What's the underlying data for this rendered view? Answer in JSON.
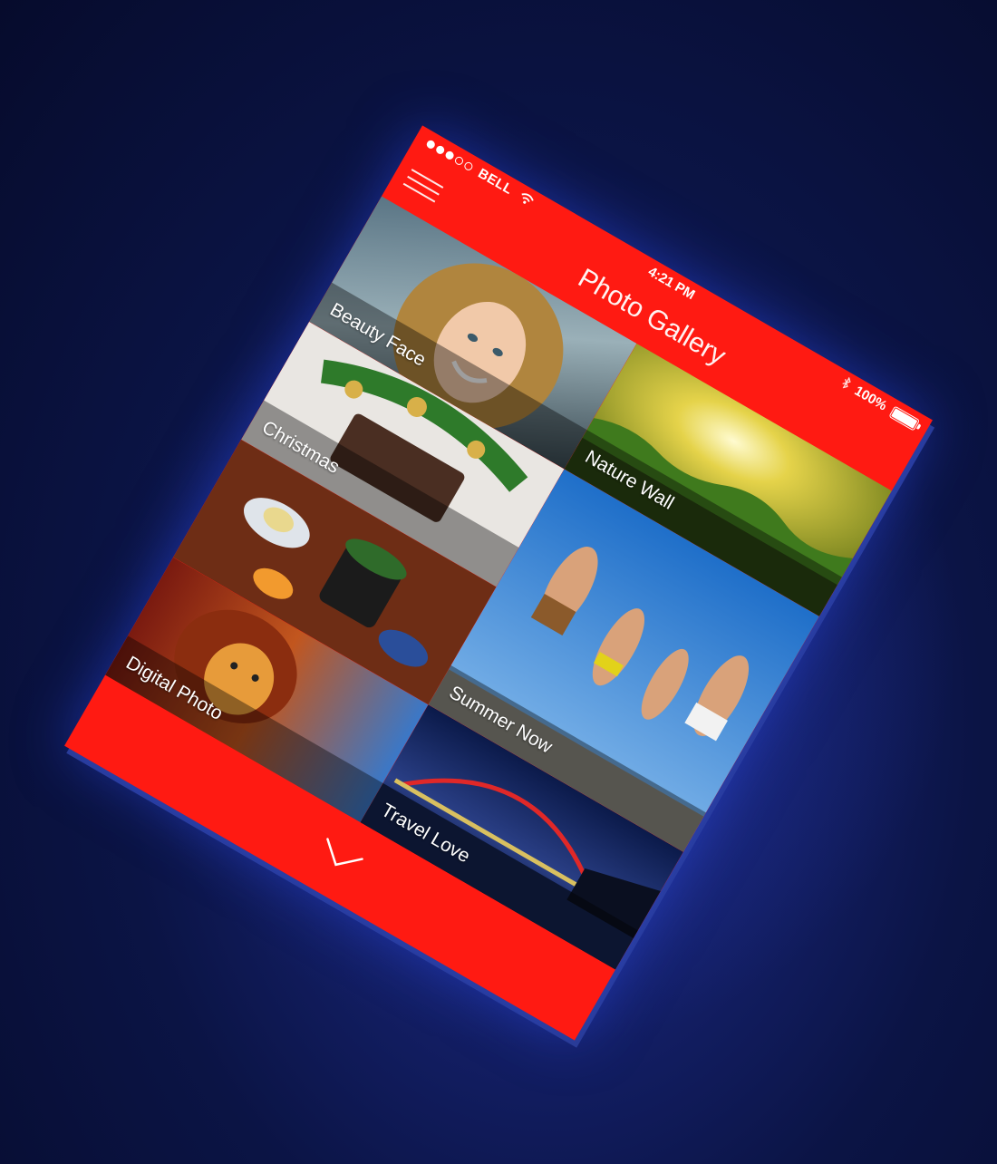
{
  "status_bar": {
    "signal_filled": 3,
    "signal_total": 5,
    "carrier": "BELL",
    "time": "4:21 PM",
    "battery_text": "100%",
    "battery_level": 1.0
  },
  "nav": {
    "title": "Photo Gallery",
    "menu_icon": "hamburger-menu-icon"
  },
  "tiles": [
    {
      "label": "Beauty Face"
    },
    {
      "label": "Nature Wall"
    },
    {
      "label": "Christmas"
    },
    {
      "label": "Summer Now"
    },
    {
      "label": "Digital Photo"
    },
    {
      "label": "Travel Love"
    }
  ],
  "footer": {
    "icon": "chevron-down-icon"
  },
  "colors": {
    "accent": "#ff1a12",
    "background": "#0b1445"
  }
}
